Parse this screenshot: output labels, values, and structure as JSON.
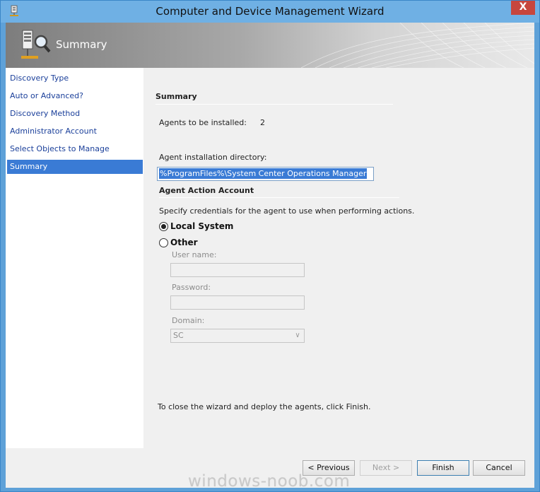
{
  "window": {
    "title": "Computer and Device Management Wizard",
    "close_glyph": "X",
    "icon": "wizard-icon"
  },
  "header": {
    "title": "Summary",
    "icon": "server-search-icon"
  },
  "sidebar": {
    "items": [
      {
        "label": "Discovery Type",
        "selected": false
      },
      {
        "label": "Auto or Advanced?",
        "selected": false
      },
      {
        "label": "Discovery Method",
        "selected": false
      },
      {
        "label": "Administrator Account",
        "selected": false
      },
      {
        "label": "Select Objects to Manage",
        "selected": false
      },
      {
        "label": "Summary",
        "selected": true
      }
    ]
  },
  "summary": {
    "section_title": "Summary",
    "agents_label": "Agents to be installed:",
    "agents_count": "2",
    "install_dir_label": "Agent installation directory:",
    "install_dir_value": "%ProgramFiles%\\System Center Operations Manager"
  },
  "action_account": {
    "section_title": "Agent Action Account",
    "description": "Specify credentials for the agent to use when performing actions.",
    "local_system_label": "Local System",
    "other_label": "Other",
    "selected": "local_system",
    "user_name_label": "User name:",
    "user_name_value": "",
    "password_label": "Password:",
    "password_value": "",
    "domain_label": "Domain:",
    "domain_value": "SC"
  },
  "footer_text": "To close the wizard and deploy the agents, click Finish.",
  "buttons": {
    "previous": "< Previous",
    "next": "Next >",
    "finish": "Finish",
    "cancel": "Cancel"
  },
  "watermark": "windows-noob.com",
  "colors": {
    "title_bar": "#6fb0e4",
    "selection": "#3a7bd5",
    "close_button": "#c7463d"
  }
}
